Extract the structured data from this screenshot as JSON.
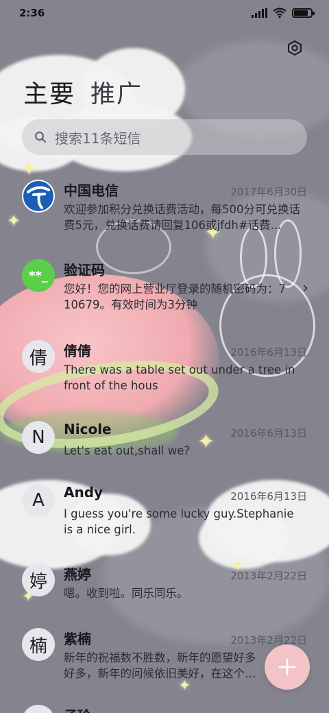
{
  "status_bar": {
    "time": "2:36",
    "icons": [
      "signal-icon",
      "wifi-icon",
      "battery-icon"
    ],
    "battery_level": 0.85
  },
  "header": {
    "tabs": [
      {
        "label": "主要",
        "active": true
      },
      {
        "label": "推广",
        "active": false
      }
    ],
    "settings_icon": "settings-hexagon-icon"
  },
  "search": {
    "placeholder": "搜索11条短信",
    "icon": "search-icon"
  },
  "conversations": [
    {
      "avatar": "",
      "avatar_kind": "china-telecom-logo",
      "name": "中国电信",
      "date": "2017年6月30日",
      "preview": "欢迎参加积分兑换话费活动，每500分可兑换话费5元，兑换话费请回复106或jfdh#话费..."
    },
    {
      "avatar": "**_",
      "avatar_kind": "text-green",
      "name": "验证码",
      "date": "",
      "preview": "您好！您的网上营业厅登录的随机密码为：710679。有效时间为3分钟",
      "has_chevron": true
    },
    {
      "avatar": "倩",
      "avatar_kind": "text",
      "name": "倩倩",
      "date": "2016年6月13日",
      "preview": "There was a table set out under a tree in front of the hous"
    },
    {
      "avatar": "N",
      "avatar_kind": "text",
      "name": "Nicole",
      "date": "2016年6月13日",
      "preview": "Let's eat out,shall we?"
    },
    {
      "avatar": "A",
      "avatar_kind": "text",
      "name": "Andy",
      "date": "2016年6月13日",
      "preview": "I guess you're some lucky guy.Stephanie is a nice girl."
    },
    {
      "avatar": "婷",
      "avatar_kind": "text",
      "name": "燕婷",
      "date": "2013年2月22日",
      "preview": "嗯。收到啦。同乐同乐。"
    },
    {
      "avatar": "楠",
      "avatar_kind": "text",
      "name": "紫楠",
      "date": "2013年2月22日",
      "preview": "新年的祝福数不胜数，新年的愿望好多好多，新年的问候依旧美好，在这个温馨的时刻"
    },
    {
      "avatar": "",
      "avatar_kind": "text",
      "name": "子玲",
      "date": "",
      "preview": ""
    }
  ],
  "fab": {
    "icon": "plus-icon",
    "color": "#f2c4c8"
  },
  "colors": {
    "accent_green": "#5ccf4a",
    "telecom_blue": "#1a5fb4"
  }
}
